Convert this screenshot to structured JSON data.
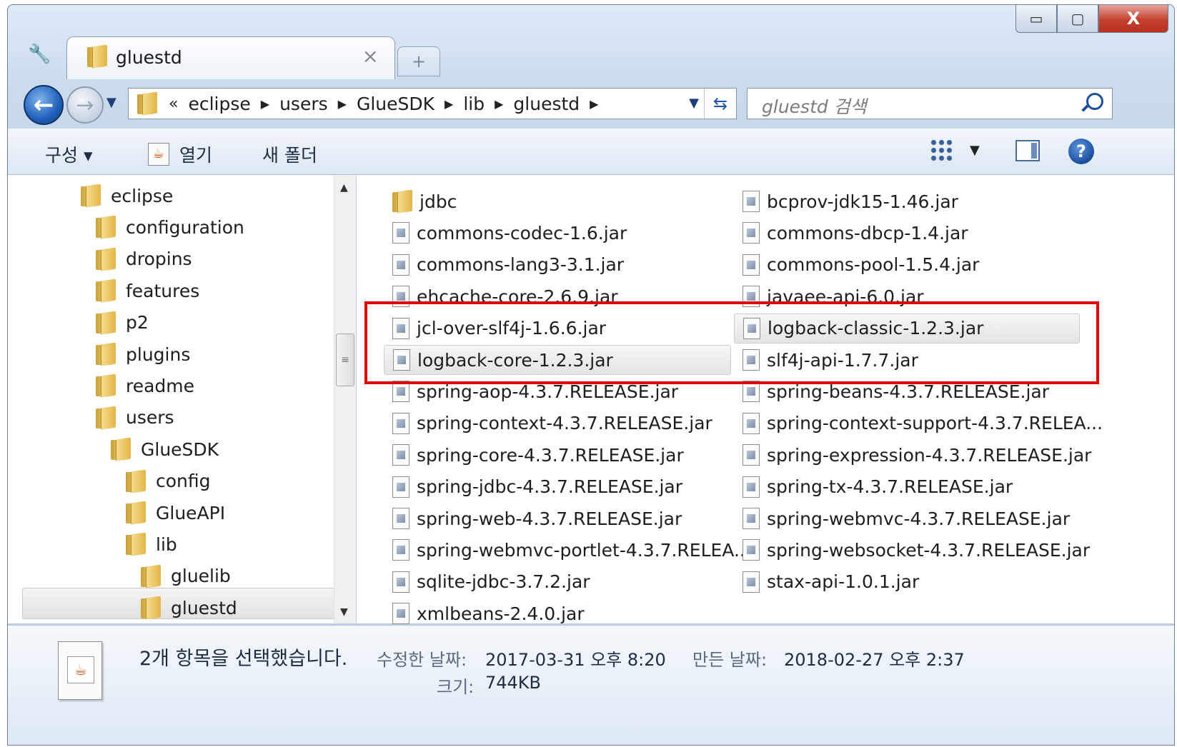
{
  "tab": {
    "title": "gluestd",
    "close_glyph": "×",
    "new_tab_glyph": "+"
  },
  "window_controls": {
    "minimize": "▭",
    "maximize": "▢",
    "close": "X"
  },
  "address_bar": {
    "overflow_glyph": "«",
    "breadcrumbs": [
      "eclipse",
      "users",
      "GlueSDK",
      "lib",
      "gluestd"
    ]
  },
  "search": {
    "placeholder": "gluestd 검색"
  },
  "command_bar": {
    "organize": "구성 ▾",
    "open": "열기",
    "new_folder": "새 폴더"
  },
  "tree": [
    {
      "label": "eclipse",
      "depth": 0
    },
    {
      "label": "configuration",
      "depth": 1
    },
    {
      "label": "dropins",
      "depth": 1
    },
    {
      "label": "features",
      "depth": 1
    },
    {
      "label": "p2",
      "depth": 1
    },
    {
      "label": "plugins",
      "depth": 1
    },
    {
      "label": "readme",
      "depth": 1
    },
    {
      "label": "users",
      "depth": 1
    },
    {
      "label": "GlueSDK",
      "depth": 2
    },
    {
      "label": "config",
      "depth": 3
    },
    {
      "label": "GlueAPI",
      "depth": 3
    },
    {
      "label": "lib",
      "depth": 3
    },
    {
      "label": "gluelib",
      "depth": 4
    },
    {
      "label": "gluestd",
      "depth": 4,
      "selected": true
    }
  ],
  "files_col1": [
    {
      "name": "jdbc",
      "type": "folder"
    },
    {
      "name": "commons-codec-1.6.jar",
      "type": "jar"
    },
    {
      "name": "commons-lang3-3.1.jar",
      "type": "jar"
    },
    {
      "name": "ehcache-core-2.6.9.jar",
      "type": "jar"
    },
    {
      "name": "jcl-over-slf4j-1.6.6.jar",
      "type": "jar"
    },
    {
      "name": "logback-core-1.2.3.jar",
      "type": "jar",
      "selected": true
    },
    {
      "name": "spring-aop-4.3.7.RELEASE.jar",
      "type": "jar"
    },
    {
      "name": "spring-context-4.3.7.RELEASE.jar",
      "type": "jar"
    },
    {
      "name": "spring-core-4.3.7.RELEASE.jar",
      "type": "jar"
    },
    {
      "name": "spring-jdbc-4.3.7.RELEASE.jar",
      "type": "jar"
    },
    {
      "name": "spring-web-4.3.7.RELEASE.jar",
      "type": "jar"
    },
    {
      "name": "spring-webmvc-portlet-4.3.7.RELEA...",
      "type": "jar"
    },
    {
      "name": "sqlite-jdbc-3.7.2.jar",
      "type": "jar"
    },
    {
      "name": "xmlbeans-2.4.0.jar",
      "type": "jar"
    }
  ],
  "files_col2": [
    {
      "name": "bcprov-jdk15-1.46.jar",
      "type": "jar"
    },
    {
      "name": "commons-dbcp-1.4.jar",
      "type": "jar"
    },
    {
      "name": "commons-pool-1.5.4.jar",
      "type": "jar"
    },
    {
      "name": "javaee-api-6.0.jar",
      "type": "jar"
    },
    {
      "name": "logback-classic-1.2.3.jar",
      "type": "jar",
      "selected": true
    },
    {
      "name": "slf4j-api-1.7.7.jar",
      "type": "jar"
    },
    {
      "name": "spring-beans-4.3.7.RELEASE.jar",
      "type": "jar"
    },
    {
      "name": "spring-context-support-4.3.7.RELEA...",
      "type": "jar"
    },
    {
      "name": "spring-expression-4.3.7.RELEASE.jar",
      "type": "jar"
    },
    {
      "name": "spring-tx-4.3.7.RELEASE.jar",
      "type": "jar"
    },
    {
      "name": "spring-webmvc-4.3.7.RELEASE.jar",
      "type": "jar"
    },
    {
      "name": "spring-websocket-4.3.7.RELEASE.jar",
      "type": "jar"
    },
    {
      "name": "stax-api-1.0.1.jar",
      "type": "jar"
    }
  ],
  "details": {
    "selection_text": "2개 항목을 선택했습니다.",
    "modified_label": "수정한 날짜:",
    "modified_value": "2017-03-31 오후 8:20",
    "created_label": "만든 날짜:",
    "created_value": "2018-02-27 오후 2:37",
    "size_label": "크기:",
    "size_value": "744KB"
  },
  "colors": {
    "highlight_box": "#e00000",
    "accent": "#1f5fb8"
  }
}
